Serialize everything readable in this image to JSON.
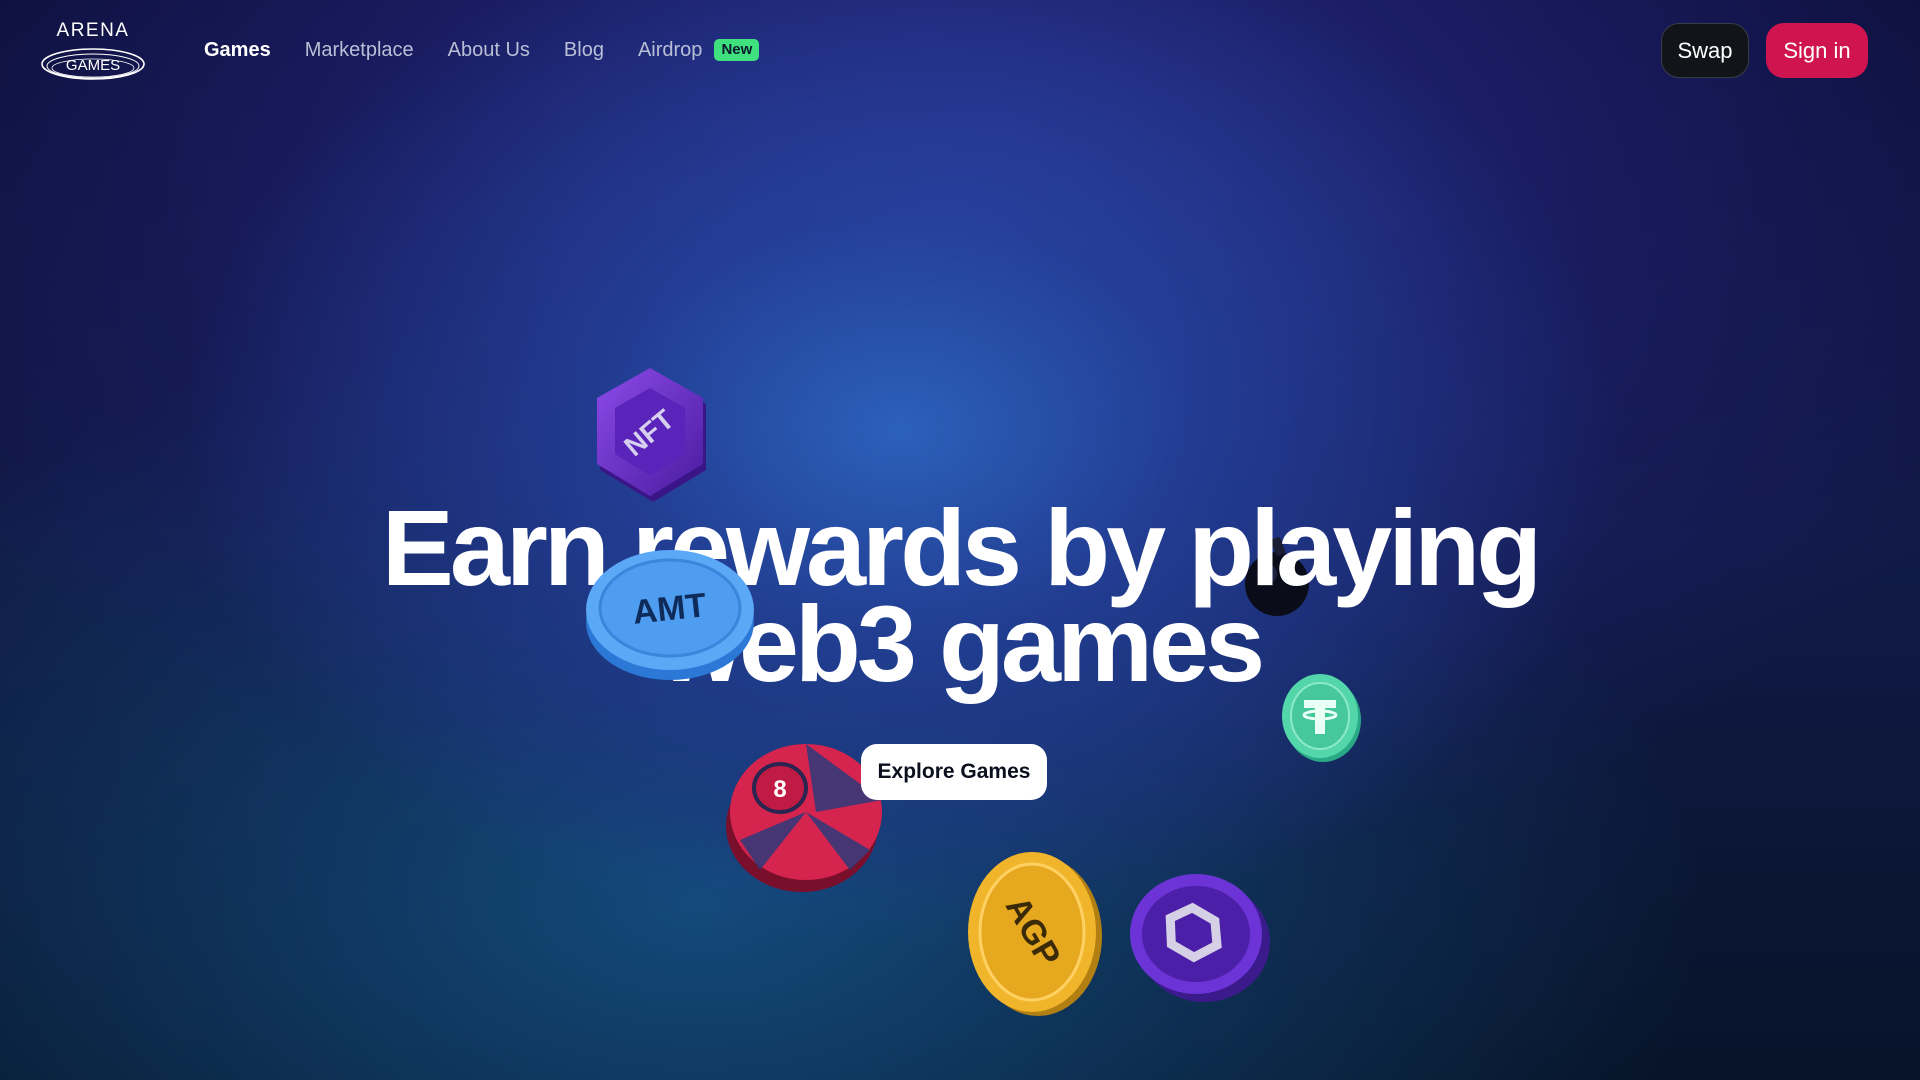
{
  "brand": {
    "name_top": "ARENA",
    "name_bottom": "GAMES"
  },
  "nav": {
    "items": [
      {
        "label": "Games",
        "active": true
      },
      {
        "label": "Marketplace",
        "active": false
      },
      {
        "label": "About Us",
        "active": false
      },
      {
        "label": "Blog",
        "active": false
      },
      {
        "label": "Airdrop",
        "active": false,
        "badge": "New"
      }
    ]
  },
  "actions": {
    "swap_label": "Swap",
    "signin_label": "Sign in"
  },
  "hero": {
    "line1": "Earn rewards by playing",
    "line2": "web3 games",
    "cta_label": "Explore Games"
  },
  "tokens": {
    "nft": "NFT",
    "amt": "AMT",
    "agp": "AGP"
  },
  "colors": {
    "accent": "#d0144f",
    "badge": "#3fe07e",
    "background_top": "#0d0f3a",
    "background_glow": "#2c64be"
  }
}
